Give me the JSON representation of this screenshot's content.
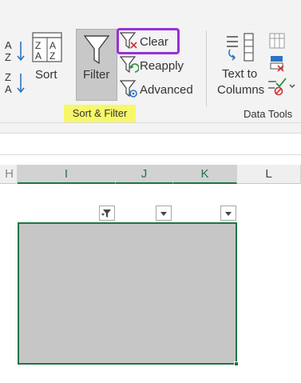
{
  "ribbon": {
    "sort_group_label": "Sort & Filter",
    "data_tools_label": "Data Tools",
    "sort_label": "Sort",
    "filter_label": "Filter",
    "clear_label": "Clear",
    "reapply_label": "Reapply",
    "advanced_label": "Advanced",
    "text_to_columns_line1": "Text to",
    "text_to_columns_line2": "Columns",
    "highlight_color": "#9a2fd6",
    "group_label_highlight": "#f7f76a"
  },
  "sheet": {
    "columns": [
      "I",
      "J",
      "K",
      "L"
    ],
    "left_partial_col": "H",
    "selection_color": "#217346",
    "range_fill": "#c6c6c6"
  }
}
